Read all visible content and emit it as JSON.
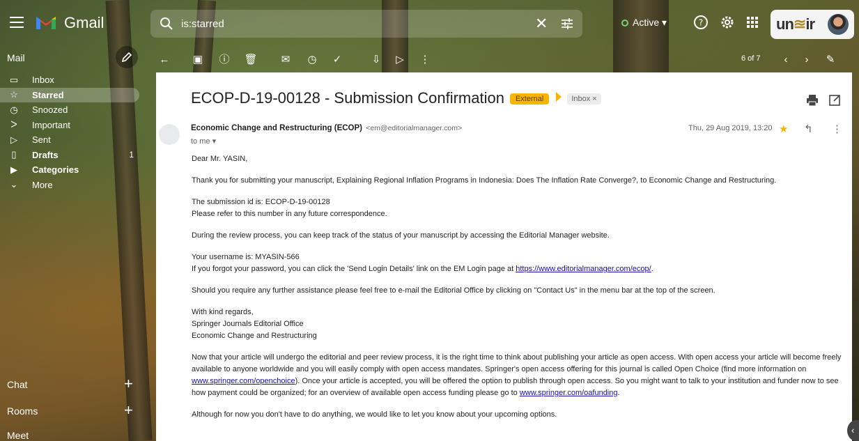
{
  "app": {
    "name": "Gmail",
    "search_value": "is:starred",
    "status": "Active",
    "account_logo_part1": "un",
    "account_logo_part2": "ir"
  },
  "sidebar": {
    "mail_label": "Mail",
    "items": [
      {
        "label": "Inbox",
        "icon": "inbox-icon",
        "count": "",
        "bold": false,
        "active": false
      },
      {
        "label": "Starred",
        "icon": "star-icon",
        "count": "",
        "bold": true,
        "active": true
      },
      {
        "label": "Snoozed",
        "icon": "clock-icon",
        "count": "",
        "bold": false,
        "active": false
      },
      {
        "label": "Important",
        "icon": "important-icon",
        "count": "",
        "bold": false,
        "active": false
      },
      {
        "label": "Sent",
        "icon": "send-icon",
        "count": "",
        "bold": false,
        "active": false
      },
      {
        "label": "Drafts",
        "icon": "draft-icon",
        "count": "1",
        "bold": true,
        "active": false
      },
      {
        "label": "Categories",
        "icon": "label-icon",
        "count": "",
        "bold": true,
        "active": false
      },
      {
        "label": "More",
        "icon": "chevron-down-icon",
        "count": "",
        "bold": false,
        "active": false
      }
    ],
    "chat_label": "Chat",
    "rooms_label": "Rooms",
    "meet_label": "Meet"
  },
  "toolbar": {
    "pager": "6 of 7"
  },
  "email": {
    "subject": "ECOP-D-19-00128 - Submission Confirmation",
    "label_external": "External",
    "label_inbox": "Inbox",
    "sender_name": "Economic Change and Restructuring (ECOP)",
    "sender_email": "<em@editorialmanager.com>",
    "to": "to me",
    "date": "Thu, 29 Aug 2019, 13:20",
    "body": {
      "greeting": "Dear Mr. YASIN,",
      "p1": "Thank you for submitting your manuscript, Explaining Regional Inflation Programs in Indonesia: Does The Inflation Rate Converge?, to Economic Change and Restructuring.",
      "p2_line1": "The submission id is: ECOP-D-19-00128",
      "p2_line2": "Please refer to this number in any future correspondence.",
      "p3": "During the review process, you can keep track of the status of your manuscript by accessing the Editorial Manager website.",
      "p4_line1": "Your username is: MYASIN-566",
      "p4_line2_pre": "If you forgot your password, you can click the 'Send Login Details' link on the EM Login page at ",
      "p4_link": "https://www.editorialmanager.com/ecop/",
      "p4_line2_post": ".",
      "p5": "Should you require any further assistance please feel free to e-mail the Editorial Office by clicking on \"Contact Us\" in the menu bar at the top of the screen.",
      "p6_line1": "With kind regards,",
      "p6_line2": "Springer Journals Editorial Office",
      "p6_line3": "Economic Change and Restructuring",
      "p7_pre": "Now that your article will undergo the editorial and peer review process, it is the right time to think about publishing your article as open access. With open access your article will become freely available to anyone worldwide and you will easily comply with open access mandates. Springer's open access offering for this journal is called Open Choice (find more information on ",
      "p7_link1": "www.springer.com/openchoice",
      "p7_mid": "). Once your article is accepted, you will be offered the option to publish through open access. So you might want to talk to your institution and funder now to see how payment could be organized; for an overview of available open access funding please go to ",
      "p7_link2": "www.springer.com/oafunding",
      "p7_post": ".",
      "p8": "Although for now you don't have to do anything, we would like to let you know about your upcoming options."
    }
  },
  "colors": {
    "external_label": "#f7b500",
    "star": "#f7b500",
    "active_status": "#7ed36b",
    "link": "#1a0dab"
  }
}
